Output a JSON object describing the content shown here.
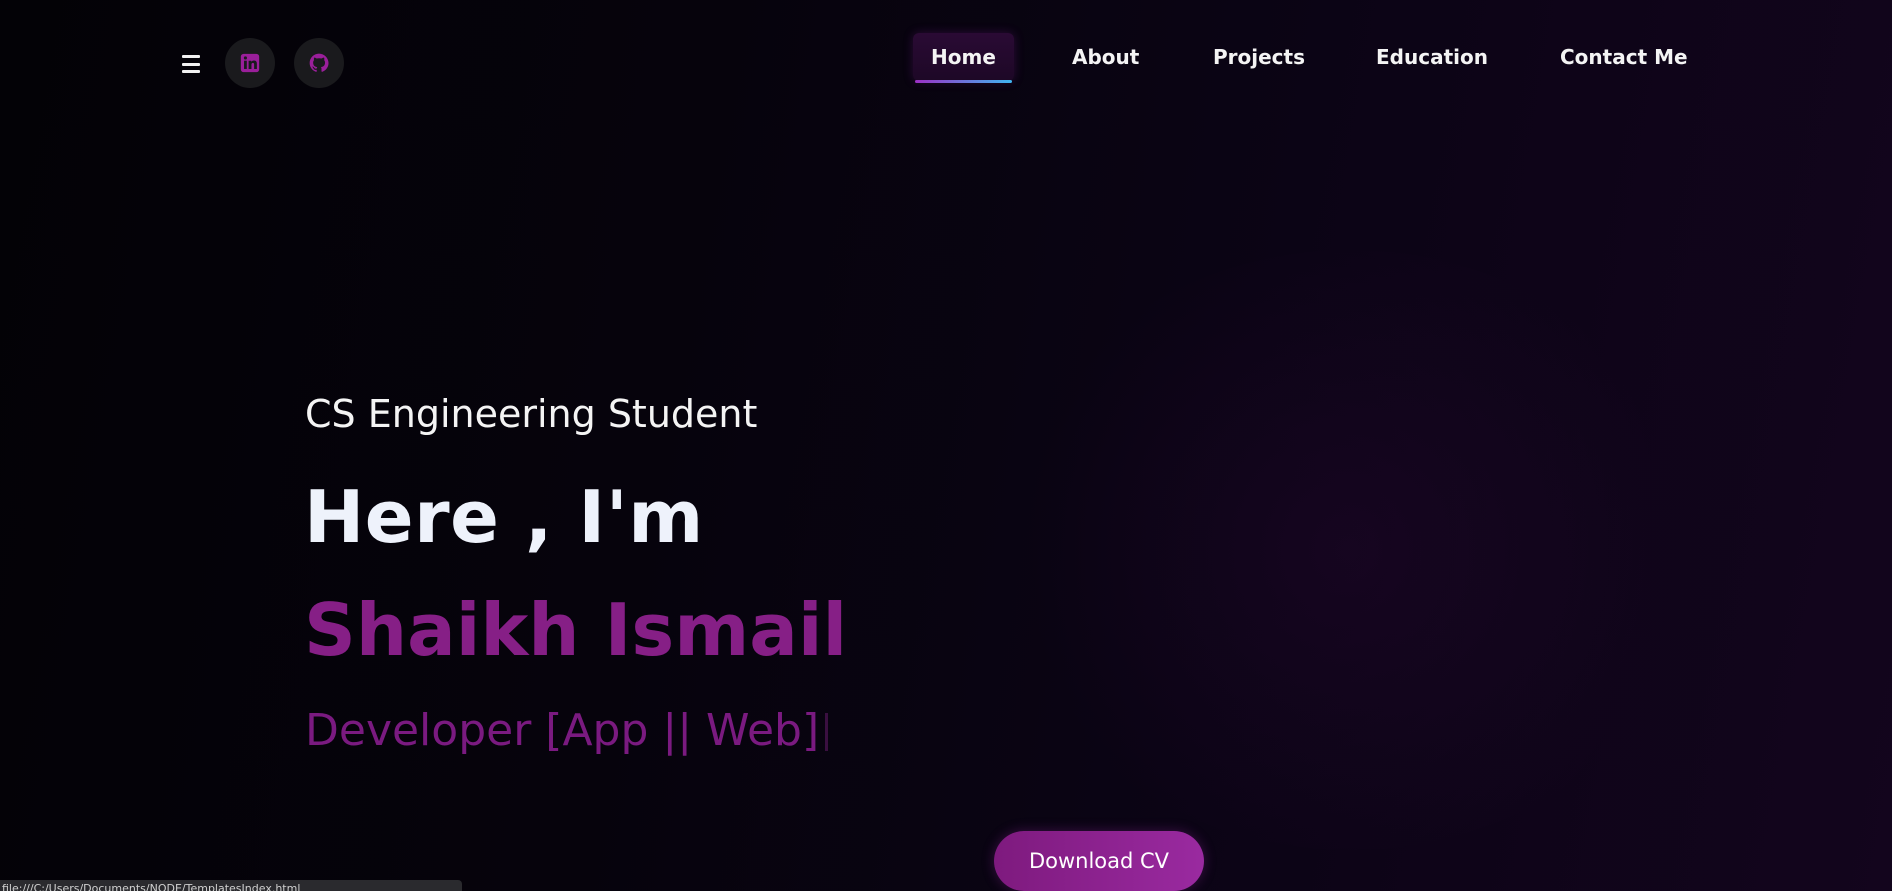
{
  "header": {
    "menu_icon": "hamburger-icon",
    "social": [
      {
        "name": "linkedin",
        "icon": "linkedin-icon",
        "color": "#9a1f9a"
      },
      {
        "name": "github",
        "icon": "github-icon",
        "color": "#9a1f9a"
      }
    ]
  },
  "nav": {
    "items": [
      {
        "label": "Home",
        "active": true
      },
      {
        "label": "About",
        "active": false
      },
      {
        "label": "Projects",
        "active": false
      },
      {
        "label": "Education",
        "active": false
      },
      {
        "label": "Contact Me",
        "active": false
      }
    ]
  },
  "hero": {
    "subtitle": "CS Engineering Student",
    "greeting": "Here , I'm",
    "name": "Shaikh Ismail",
    "role": "Developer [App || Web]",
    "cta_label": "Download CV"
  },
  "status_bar": {
    "text": "file:///C:/Users/Documents/NODE/TemplatesIndex.html"
  },
  "colors": {
    "accent": "#861f86",
    "accent_bright": "#9a2aa0",
    "background": "#06030c",
    "nav_underline_start": "#9b2fc4",
    "nav_underline_end": "#3fb6f0"
  }
}
